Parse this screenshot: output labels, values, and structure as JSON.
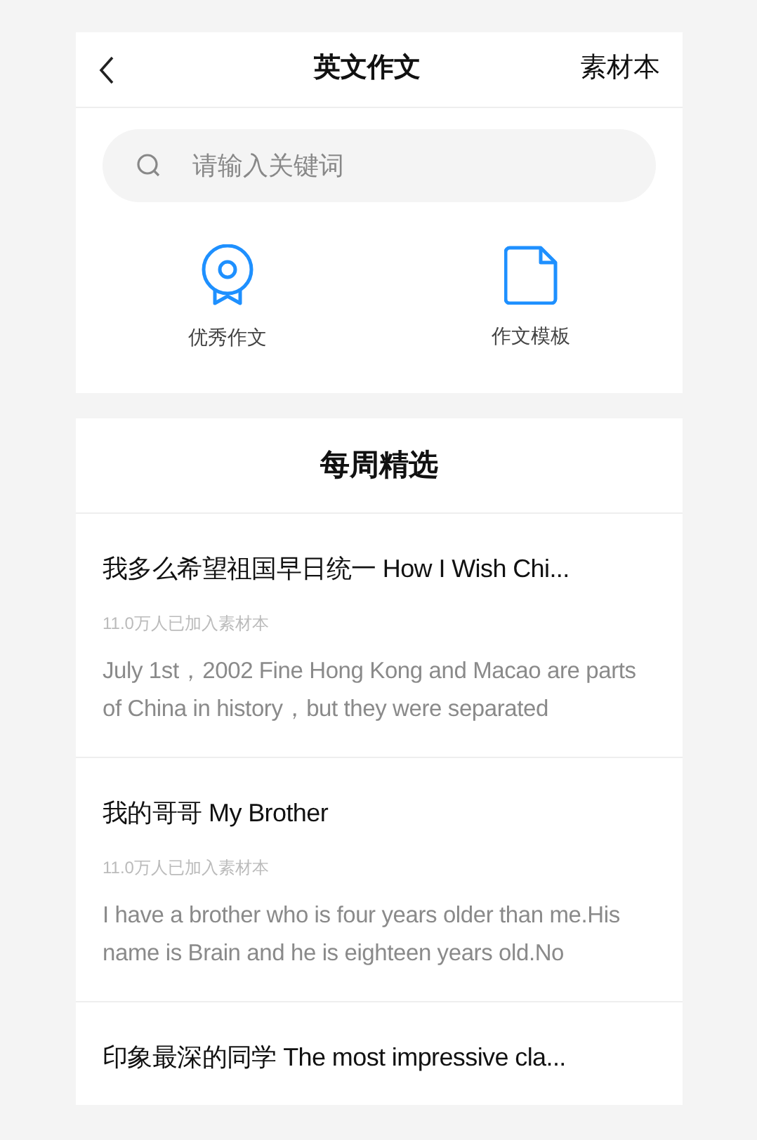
{
  "header": {
    "title": "英文作文",
    "action": "素材本"
  },
  "search": {
    "placeholder": "请输入关键词"
  },
  "shortcuts": [
    {
      "kind": "medal",
      "label": "优秀作文"
    },
    {
      "kind": "document",
      "label": "作文模板"
    }
  ],
  "section": {
    "title": "每周精选"
  },
  "articles": [
    {
      "title": "我多么希望祖国早日统一 How I Wish Chi...",
      "meta": "11.0万人已加入素材本",
      "excerpt": "July 1st，2002 Fine Hong Kong and Macao are parts of China in history，but they were separated"
    },
    {
      "title": "我的哥哥 My Brother",
      "meta": "11.0万人已加入素材本",
      "excerpt": "I have a brother who is four years older than me.His name is Brain and he is eighteen years old.No"
    },
    {
      "title": "印象最深的同学 The most impressive cla..."
    }
  ]
}
